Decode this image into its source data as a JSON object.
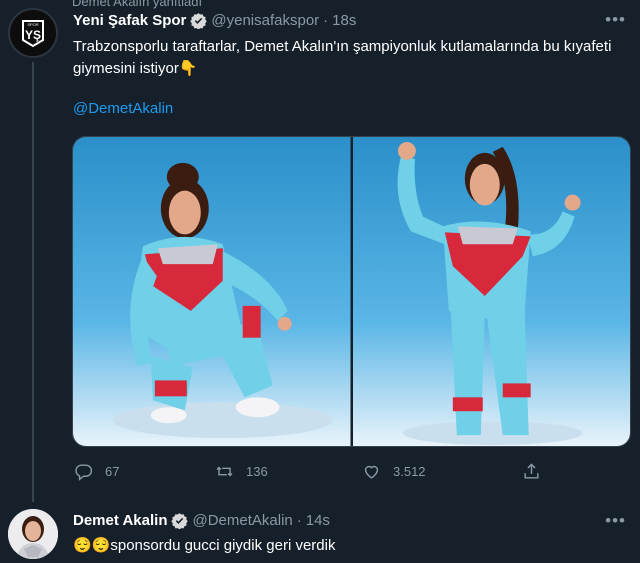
{
  "reply_context": "Demet Akalın yanıtladı",
  "tweets": [
    {
      "name": "Yeni Şafak Spor",
      "handle": "@yenisafakspor",
      "separator": "·",
      "time": "18s",
      "text": "Trabzonsporlu taraftarlar, Demet Akalın'ın şampiyonluk kutlamalarında bu kıyafeti giymesini istiyor👇",
      "mention": "@DemetAkalin",
      "avatar_icon": "yeni-safak-spor-logo",
      "avatar_text": "YŞ",
      "avatar_subtext": "SPOR",
      "stats": {
        "replies": "67",
        "retweets": "136",
        "likes": "3.512"
      }
    },
    {
      "name": "Demet Akalin",
      "handle": "@DemetAkalin",
      "separator": "·",
      "time": "14s",
      "emoji": "😌😌",
      "text": "sponsordu gucci giydik geri verdik"
    }
  ],
  "colors": {
    "background": "#15202b",
    "text_muted": "#8b98a5",
    "link": "#1d9bf0",
    "divider": "#38444d",
    "verified": "#d9d9d9"
  }
}
